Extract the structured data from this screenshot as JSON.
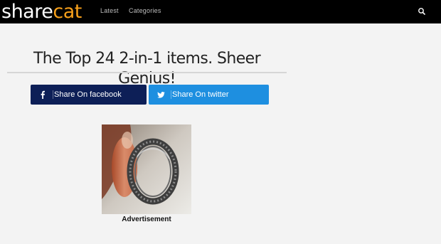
{
  "brand": {
    "logo_part1": "share",
    "logo_part2": "c",
    "logo_part3": "a",
    "logo_part4": "t",
    "accent_color": "#f7a01b"
  },
  "nav": {
    "items": [
      {
        "label": "Latest"
      },
      {
        "label": "Categories"
      }
    ],
    "search_icon": "search-icon"
  },
  "article": {
    "title": "The Top 24 2-in-1 items. Sheer Genius!"
  },
  "share": {
    "facebook": {
      "label": "Share On facebook",
      "icon": "facebook-icon",
      "color": "#0d1f57"
    },
    "twitter": {
      "label": "Share On twitter",
      "icon": "twitter-icon",
      "color": "#1e8fe0"
    }
  },
  "advertisement": {
    "image": "ring-photo",
    "label": "Advertisement"
  }
}
